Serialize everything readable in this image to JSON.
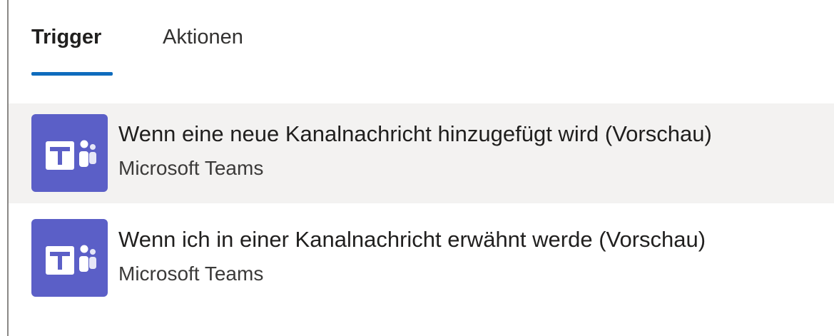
{
  "tabs": [
    {
      "label": "Trigger",
      "selected": true
    },
    {
      "label": "Aktionen",
      "selected": false
    }
  ],
  "items": [
    {
      "title": "Wenn eine neue Kanalnachricht hinzugefügt wird (Vorschau)",
      "subtitle": "Microsoft Teams",
      "icon": "microsoft-teams-icon",
      "highlighted": true
    },
    {
      "title": "Wenn ich in einer Kanalnachricht erwähnt werde (Vorschau)",
      "subtitle": "Microsoft Teams",
      "icon": "microsoft-teams-icon",
      "highlighted": false
    }
  ],
  "colors": {
    "accent": "#0f6cbd",
    "teams_purple": "#5b5fc7",
    "highlight_bg": "#f3f2f1"
  }
}
